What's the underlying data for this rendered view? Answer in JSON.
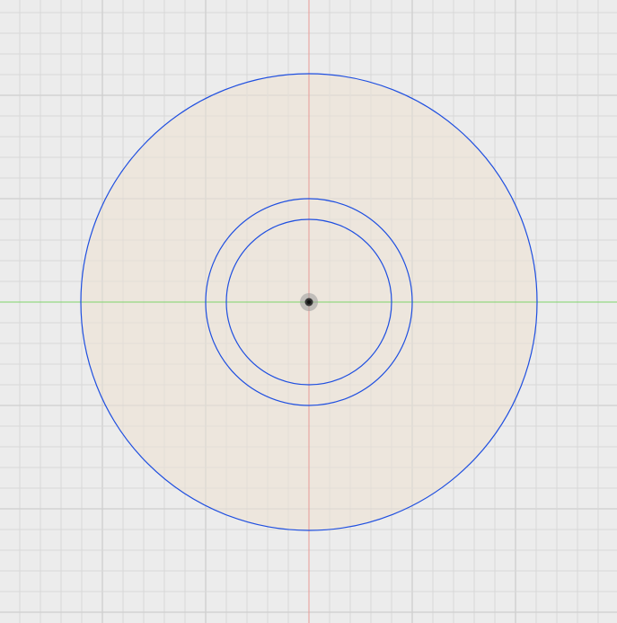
{
  "colors": {
    "background": "#ececec",
    "grid_minor": "#d8d8d8",
    "grid_major": "#cfcfcf",
    "profile_fill": "#ede4d8",
    "sketch_curve": "#1f4fe0",
    "x_axis": "#7fd46a",
    "y_axis": "#e89a96",
    "origin": "#333333"
  },
  "sketch": {
    "entities": [
      "outer-circle",
      "middle-circle",
      "inner-circle",
      "origin-point"
    ]
  }
}
